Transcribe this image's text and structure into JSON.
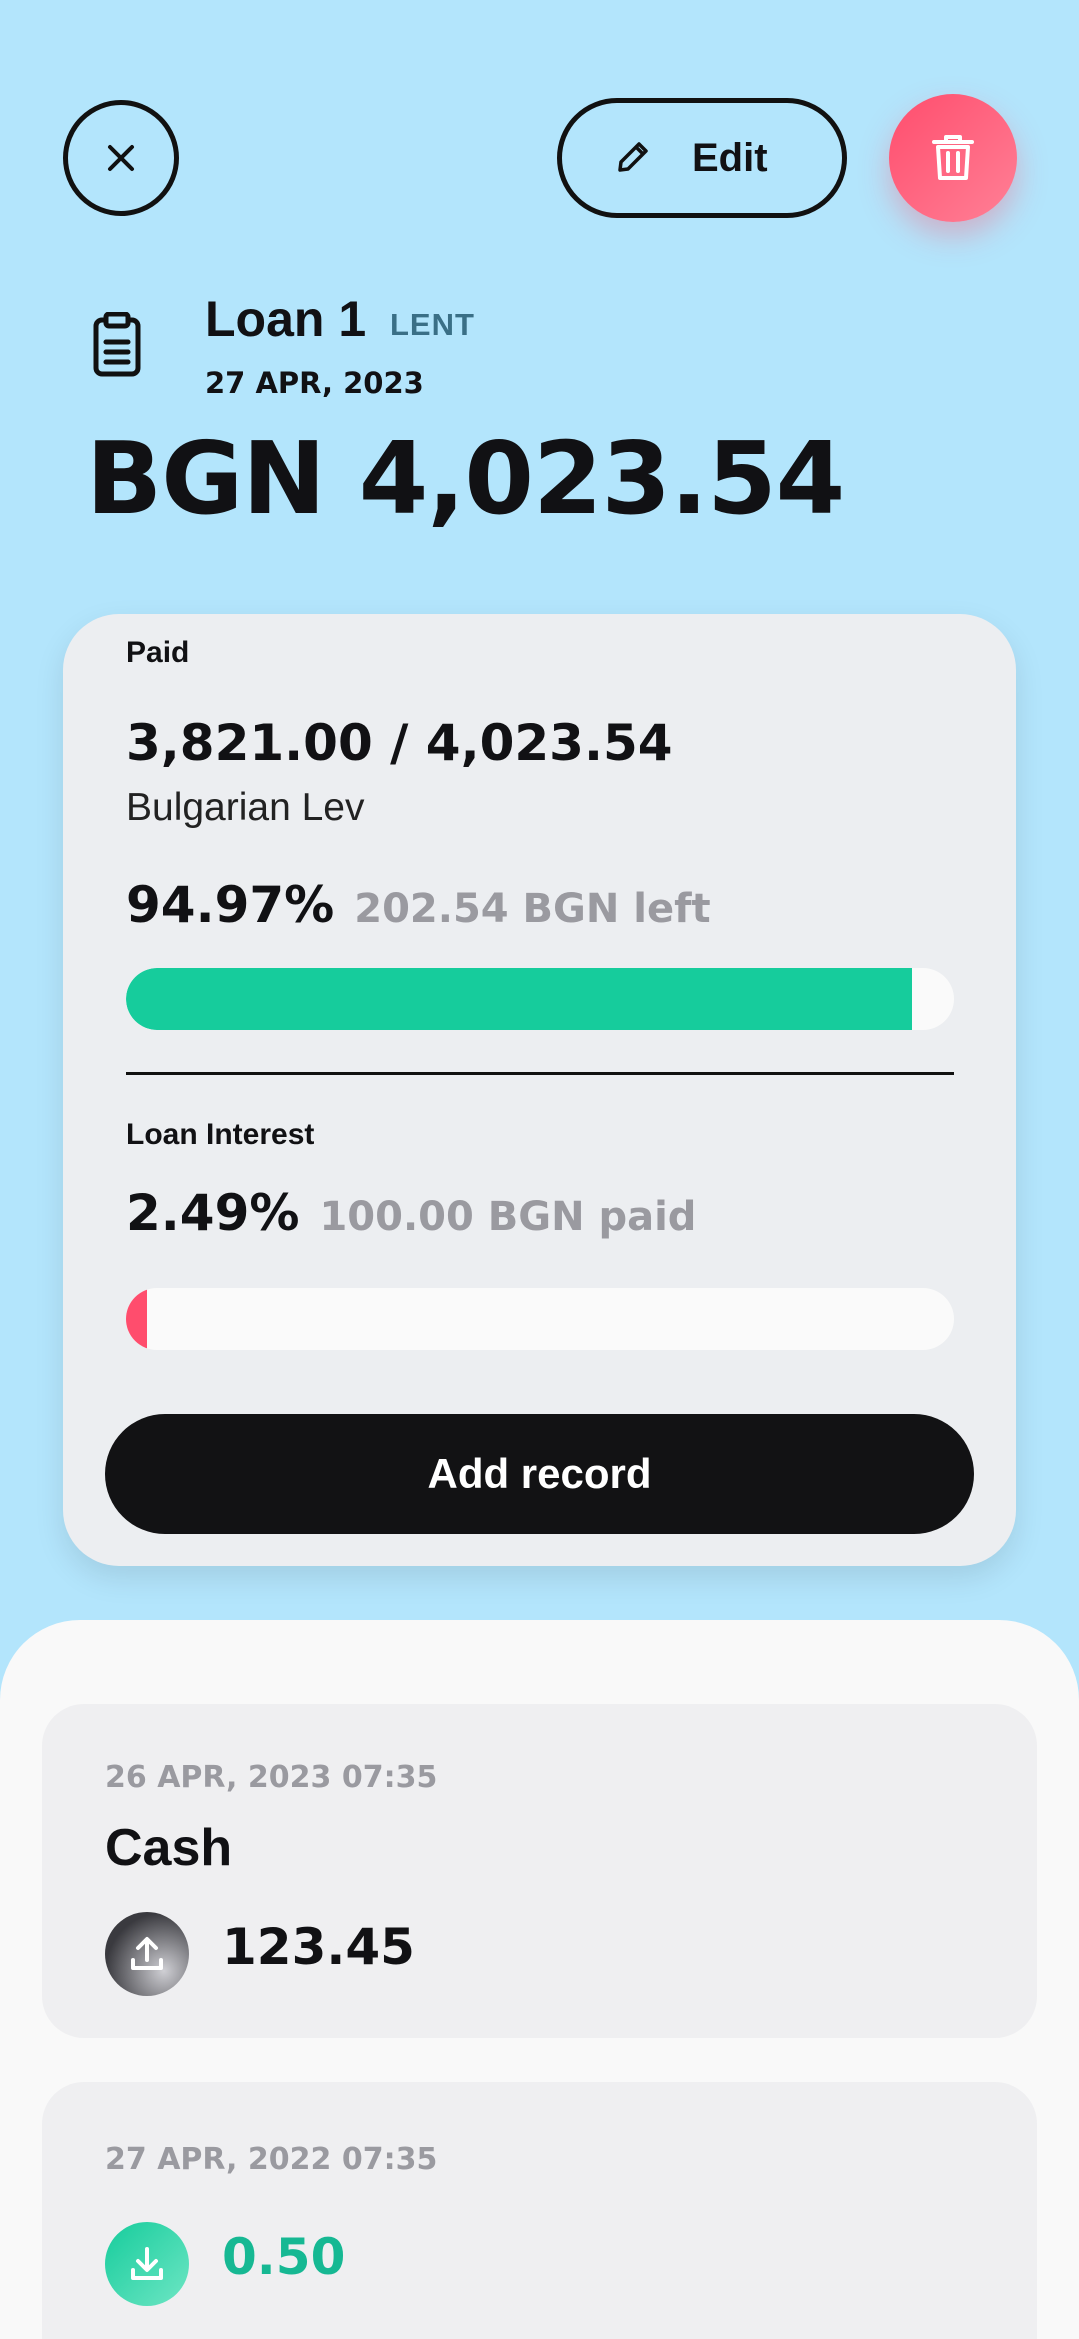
{
  "top_bar": {
    "edit_label": "Edit"
  },
  "loan": {
    "name": "Loan 1",
    "type": "LENT",
    "date": "27 APR, 2023",
    "amount": "BGN 4,023.54"
  },
  "summary": {
    "paid_label": "Paid",
    "paid_ratio": "3,821.00 / 4,023.54",
    "currency_name": "Bulgarian Lev",
    "paid_percent": "94.97%",
    "left_text": "202.54 BGN left",
    "paid_progress": 0.9497,
    "interest_label": "Loan Interest",
    "interest_percent": "2.49%",
    "interest_paid_text": "100.00 BGN paid",
    "interest_progress": 0.0249,
    "add_record_label": "Add record"
  },
  "colors": {
    "background": "#b3e5fc",
    "paid_bar": "#16cc9c",
    "interest_bar": "#ff4d6d",
    "delete_button": "#ff5c78",
    "positive_value": "#16b893"
  },
  "records": [
    {
      "date": "26 APR, 2023 07:35",
      "title": "Cash",
      "icon": "upload-icon",
      "value": "123.45"
    },
    {
      "date": "27 APR, 2022 07:35",
      "title": "",
      "icon": "download-icon",
      "value": "0.50"
    }
  ]
}
